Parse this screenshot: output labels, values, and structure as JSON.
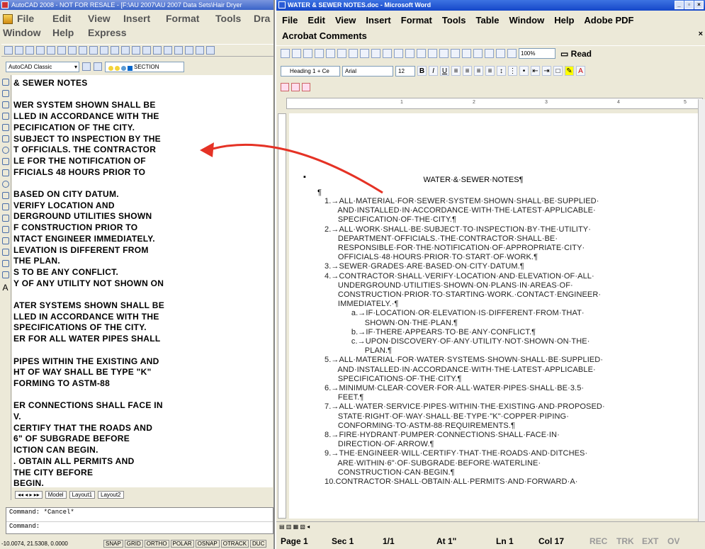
{
  "autocad": {
    "title": "AutoCAD 2008 - NOT FOR RESALE - [F:\\AU 2007\\AU 2007 Data Sets\\Hair Dryer",
    "menu_row1": [
      "File",
      "Edit",
      "View",
      "Insert",
      "Format",
      "Tools",
      "Dra"
    ],
    "menu_row2": [
      "Window",
      "Help",
      "Express"
    ],
    "workspace": "AutoCAD Classic",
    "layer": "SECTION",
    "drawing_lines": [
      "& SEWER NOTES",
      "",
      "WER SYSTEM SHOWN SHALL BE",
      "LLED IN ACCORDANCE WITH THE",
      "PECIFICATION OF THE CITY.",
      " SUBJECT TO INSPECTION BY THE",
      "T OFFICIALS. THE CONTRACTOR",
      "LE FOR THE NOTIFICATION OF",
      "FFICIALS 48 HOURS PRIOR TO",
      "",
      " BASED ON CITY DATUM.",
      " VERIFY LOCATION AND",
      "DERGROUND UTILITIES SHOWN",
      "F CONSTRUCTION PRIOR TO",
      "NTACT ENGINEER IMMEDIATELY.",
      "LEVATION IS DIFFERENT FROM",
      " THE PLAN.",
      "S TO BE ANY CONFLICT.",
      "Y OF ANY UTILITY NOT SHOWN ON",
      "",
      "ATER SYSTEMS SHOWN SHALL BE",
      "LLED IN ACCORDANCE WITH THE",
      " SPECIFICATIONS OF THE CITY.",
      "ER FOR ALL WATER PIPES SHALL",
      "",
      " PIPES WITHIN THE EXISTING AND",
      "HT OF WAY SHALL BE TYPE \"K\"",
      "FORMING TO ASTM-88",
      "",
      "ER CONNECTIONS SHALL FACE IN",
      "V.",
      " CERTIFY THAT THE ROADS AND",
      " 6\" OF SUBGRADE BEFORE",
      "ICTION CAN BEGIN.",
      ". OBTAIN ALL PERMITS AND",
      " THE CITY BEFORE",
      " BEGIN."
    ],
    "layout_tabs": [
      "Model",
      "Layout1",
      "Layout2"
    ],
    "command_history": "Command: *Cancel*",
    "command_prompt": "Command:",
    "coordinates": "-10.0074, 21.5308, 0.0000",
    "status_buttons": [
      "SNAP",
      "GRID",
      "ORTHO",
      "POLAR",
      "OSNAP",
      "OTRACK",
      "DUC"
    ]
  },
  "word": {
    "title": "WATER & SEWER NOTES.doc - Microsoft Word",
    "menu_row1": [
      "File",
      "Edit",
      "View",
      "Insert",
      "Format",
      "Tools",
      "Table",
      "Window",
      "Help",
      "Adobe PDF"
    ],
    "menu_row2": [
      "Acrobat Comments"
    ],
    "close_x": "×",
    "zoom": "100%",
    "read_label": "Read",
    "style": "Heading 1 + Ce",
    "font": "Arial",
    "font_size": "12",
    "doc_title": "WATER·&·SEWER·NOTES¶",
    "pilcrow": "¶",
    "bullet": "▪",
    "doc_lines": [
      "1.→ALL·MATERIAL·FOR·SEWER·SYSTEM·SHOWN·SHALL·BE·SUPPLIED·",
      "      AND·INSTALLED·IN·ACCORDANCE·WITH·THE·LATEST·APPLICABLE·",
      "      SPECIFICATION·OF·THE·CITY.¶",
      "2.→ALL·WORK·SHALL·BE·SUBJECT·TO·INSPECTION·BY·THE·UTILITY·",
      "      DEPARTMENT·OFFICIALS.·THE·CONTRACTOR·SHALL·BE·",
      "      RESPONSIBLE·FOR·THE·NOTIFICATION·OF·APPROPRIATE·CITY·",
      "      OFFICIALS·48·HOURS·PRIOR·TO·START·OF·WORK.¶",
      "3.→SEWER·GRADES·ARE·BASED·ON·CITY·DATUM.¶",
      "4.→CONTRACTOR·SHALL·VERIFY·LOCATION·AND·ELEVATION·OF·ALL·",
      "      UNDERGROUND·UTILITIES·SHOWN·ON·PLANS·IN·AREAS·OF·",
      "      CONSTRUCTION·PRIOR·TO·STARTING·WORK.·CONTACT·ENGINEER·",
      "      IMMEDIATELY.·¶",
      "            a.→IF·LOCATION·OR·ELEVATION·IS·DIFFERENT·FROM·THAT·",
      "                  SHOWN·ON·THE·PLAN.¶",
      "            b.→IF·THERE·APPEARS·TO·BE·ANY·CONFLICT.¶",
      "            c.→UPON·DISCOVERY·OF·ANY·UTILITY·NOT·SHOWN·ON·THE·",
      "                  PLAN.¶",
      "5.→ALL·MATERIAL·FOR·WATER·SYSTEMS·SHOWN·SHALL·BE·SUPPLIED·",
      "      AND·INSTALLED·IN·ACCORDANCE·WITH·THE·LATEST·APPLICABLE·",
      "      SPECIFICATIONS·OF·THE·CITY.¶",
      "6.→MINIMUM·CLEAR·COVER·FOR·ALL·WATER·PIPES·SHALL·BE·3.5·",
      "      FEET.¶",
      "7.→ALL·WATER·SERVICE·PIPES·WITHIN·THE·EXISTING·AND·PROPOSED·",
      "      STATE·RIGHT·OF·WAY·SHALL·BE·TYPE·\"K\"·COPPER·PIPING·",
      "      CONFORMING·TO·ASTM-88·REQUIREMENTS.¶",
      "8.→FIRE·HYDRANT·PUMPER·CONNECTIONS·SHALL·FACE·IN·",
      "      DIRECTION·OF·ARROW.¶",
      "9.→THE·ENGINEER·WILL·CERTIFY·THAT·THE·ROADS·AND·DITCHES·",
      "      ARE·WITHIN·6\"·OF·SUBGRADE·BEFORE·WATERLINE·",
      "      CONSTRUCTION·CAN·BEGIN.¶",
      "10.CONTRACTOR·SHALL·OBTAIN·ALL·PERMITS·AND·FORWARD·A·"
    ],
    "status": {
      "page": "Page 1",
      "sec": "Sec 1",
      "pages": "1/1",
      "at": "At 1\"",
      "ln": "Ln 1",
      "col": "Col 17",
      "rec": "REC",
      "trk": "TRK",
      "ext": "EXT",
      "ovr": "OV"
    }
  },
  "colors": {
    "arrow": "#e53225"
  }
}
